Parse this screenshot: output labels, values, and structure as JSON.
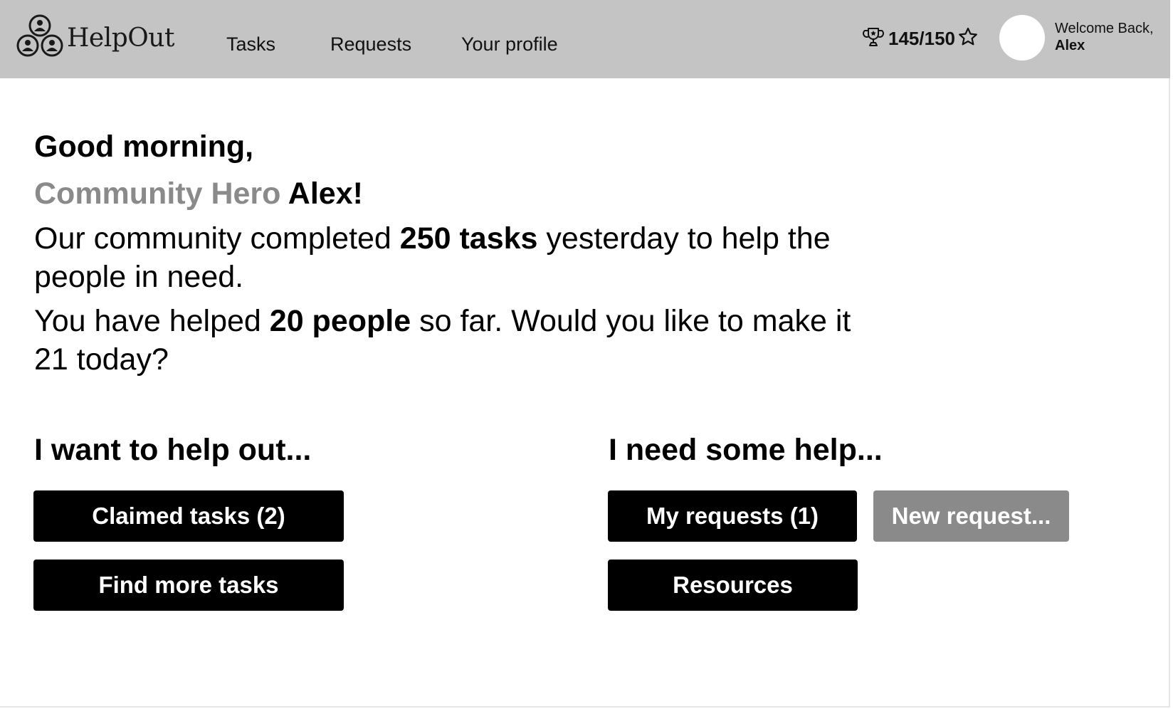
{
  "header": {
    "app_name": "HelpOut",
    "nav": {
      "tasks": "Tasks",
      "requests": "Requests",
      "profile": "Your profile"
    },
    "points": "145/150",
    "welcome_label": "Welcome Back,",
    "user_name": "Alex"
  },
  "greeting": {
    "salutation": "Good morning,",
    "title": "Community Hero",
    "name": "Alex!",
    "community_prefix": "Our community completed ",
    "community_count": "250 tasks",
    "community_suffix": " yesterday to help the people in need.",
    "personal_prefix": "You have helped ",
    "personal_count": "20 people",
    "personal_suffix": " so far. Would you like to make it 21 today?"
  },
  "help_out": {
    "title": "I want to help out...",
    "claimed_label": "Claimed tasks (2)",
    "find_label": "Find more tasks"
  },
  "need_help": {
    "title": "I need some help...",
    "my_requests_label": "My requests (1)",
    "new_request_label": "New request...",
    "resources_label": "Resources"
  },
  "icons": {
    "logo": "people-group-icon",
    "trophy": "trophy-icon",
    "star": "star-outline-icon"
  },
  "colors": {
    "header_bg": "#c4c4c4",
    "primary_button": "#000000",
    "secondary_button": "#8a8a8a",
    "hero_title": "#8a8a8a"
  }
}
